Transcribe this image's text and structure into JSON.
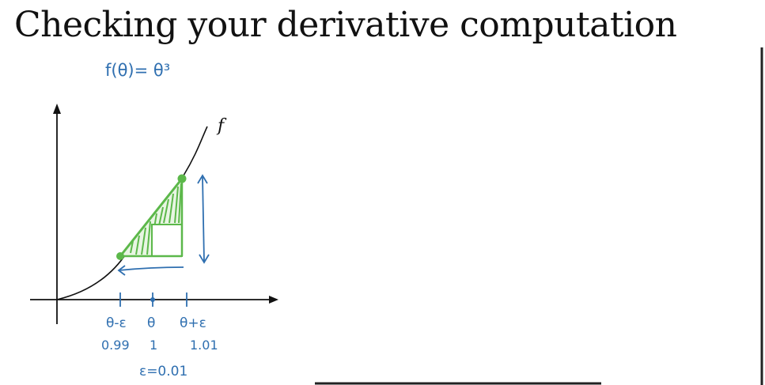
{
  "slide": {
    "title": "Checking your derivative computation"
  },
  "annotations": {
    "function_def": "f(θ)= θ³",
    "curve_label": "f",
    "tick_left": "θ-ε",
    "tick_mid": "θ",
    "tick_right": "θ+ε",
    "value_left": "0.99",
    "value_mid": "1",
    "value_right": "1.01",
    "epsilon_def": "ε=0.01"
  },
  "colors": {
    "ink": "#111111",
    "pen_blue": "#2f6fb0",
    "pen_green": "#5cb84a"
  }
}
